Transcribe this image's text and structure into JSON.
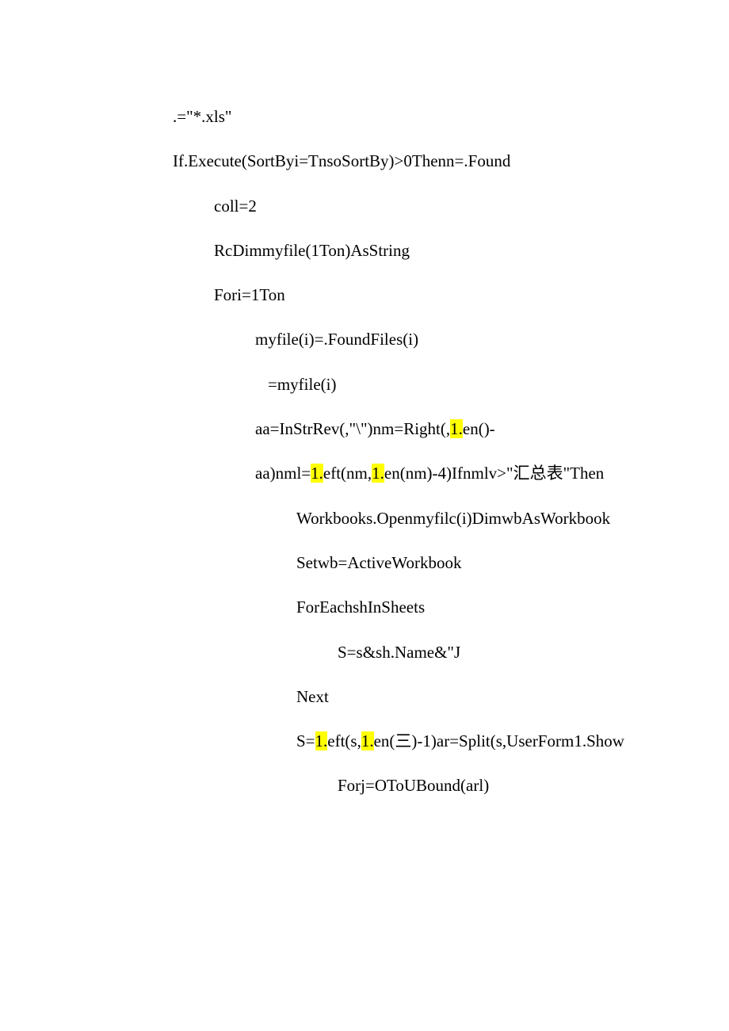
{
  "lines": [
    {
      "indent": "indent-0",
      "segments": [
        {
          "t": ".=\"*.xls\""
        }
      ]
    },
    {
      "indent": "indent-0",
      "segments": [
        {
          "t": "If.Execute(SortByi=TnsoSortBy)>0Thenn=.Found"
        }
      ]
    },
    {
      "indent": "indent-1",
      "segments": [
        {
          "t": "coll=2"
        }
      ]
    },
    {
      "indent": "indent-1",
      "segments": [
        {
          "t": "RcDimmyfile(1Ton)AsString"
        }
      ]
    },
    {
      "indent": "indent-1",
      "segments": [
        {
          "t": "Fori=1Ton"
        }
      ]
    },
    {
      "indent": "indent-2",
      "segments": [
        {
          "t": "myfile(i)=.FoundFiles(i)"
        }
      ]
    },
    {
      "indent": "indent-2b",
      "segments": [
        {
          "t": "=myfile(i)"
        }
      ]
    },
    {
      "indent": "indent-2",
      "segments": [
        {
          "t": "aa=InStrRev(,\"\\\")nm=Right(,"
        },
        {
          "t": "1.",
          "hl": true
        },
        {
          "t": "en()-"
        }
      ]
    },
    {
      "indent": "indent-2",
      "segments": [
        {
          "t": "aa)nml="
        },
        {
          "t": "1.",
          "hl": true
        },
        {
          "t": "eft(nm,"
        },
        {
          "t": "1.",
          "hl": true
        },
        {
          "t": "en(nm)-4)Ifnmlv>\"汇总表\"Then"
        }
      ]
    },
    {
      "indent": "indent-3",
      "segments": [
        {
          "t": "Workbooks.Openmyfilc(i)DimwbAsWorkbook"
        }
      ]
    },
    {
      "indent": "indent-3",
      "segments": [
        {
          "t": "Setwb=ActiveWorkbook"
        }
      ]
    },
    {
      "indent": "indent-3",
      "segments": [
        {
          "t": "ForEachshInSheets"
        }
      ]
    },
    {
      "indent": "indent-4",
      "segments": [
        {
          "t": "S=s&sh.Name&\"J"
        }
      ]
    },
    {
      "indent": "indent-3",
      "segments": [
        {
          "t": "Next"
        }
      ]
    },
    {
      "indent": "indent-3",
      "segments": [
        {
          "t": "S="
        },
        {
          "t": "1.",
          "hl": true
        },
        {
          "t": "eft(s,"
        },
        {
          "t": "1.",
          "hl": true
        },
        {
          "t": "en(三)-1)ar=Split(s,UserForm1.Show"
        }
      ]
    },
    {
      "indent": "indent-4",
      "segments": [
        {
          "t": "Forj=OToUBound(arl)"
        }
      ]
    }
  ]
}
